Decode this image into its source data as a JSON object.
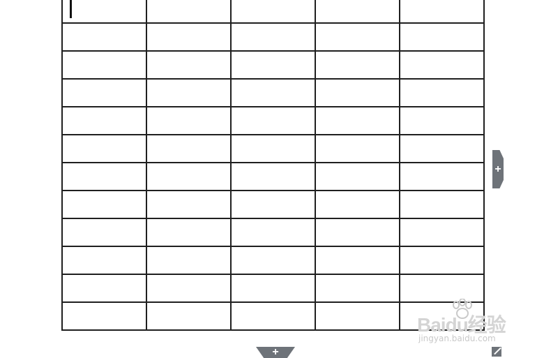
{
  "table": {
    "rows": 12,
    "cols": 5,
    "cells": []
  },
  "controls": {
    "add_column_label": "+",
    "add_row_label": "+"
  },
  "watermark": {
    "brand": "Baidu经验",
    "url": "jingyan.baidu.com"
  },
  "colors": {
    "grid_line": "#1f1f1f",
    "handle": "#6e7379",
    "watermark": "#c9c9c9"
  }
}
